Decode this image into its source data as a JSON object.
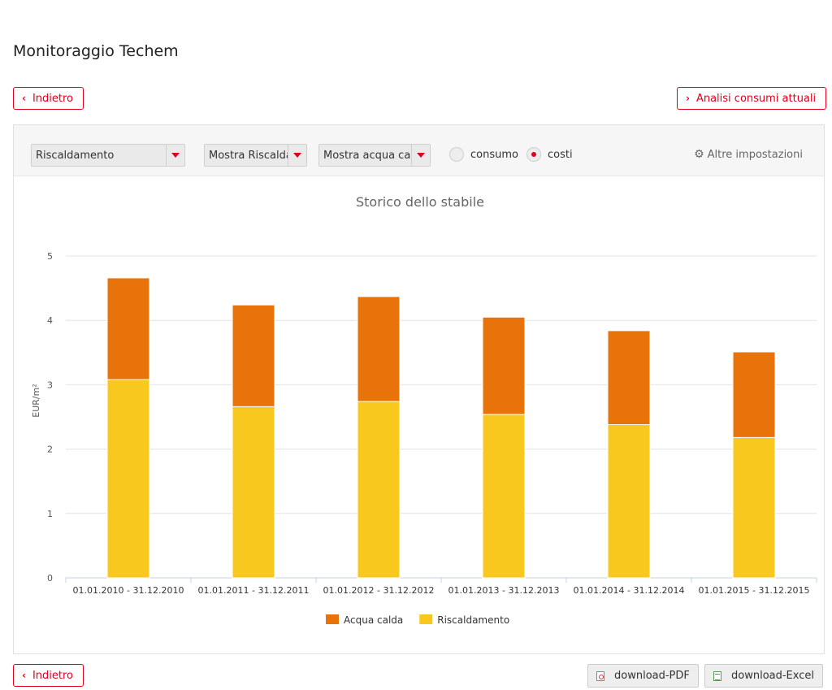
{
  "page": {
    "title": "Monitoraggio Techem"
  },
  "nav": {
    "back_label": "Indietro",
    "analysis_label": "Analisi consumi attuali",
    "back_bottom_label": "Indietro"
  },
  "toolbar": {
    "type_select": "Riscaldamento",
    "heating_select": "Mostra Riscalda",
    "water_select": "Mostra acqua calc",
    "radio_consumption": "consumo",
    "radio_costs": "costi",
    "radio_selected": "costi",
    "settings_label": "Altre impostazioni",
    "settings_icon": "gear-icon"
  },
  "chart_data": {
    "type": "bar",
    "stacked": true,
    "title": "Storico dello stabile",
    "xlabel": "",
    "ylabel": "EUR/m²",
    "ylim": [
      0,
      5
    ],
    "yticks": [
      "0",
      "1",
      "2",
      "3",
      "4",
      "5"
    ],
    "grid": true,
    "legend_position": "bottom",
    "categories": [
      "01.01.2010 - 31.12.2010",
      "01.01.2011 - 31.12.2011",
      "01.01.2012 - 31.12.2012",
      "01.01.2013 - 31.12.2013",
      "01.01.2014 - 31.12.2014",
      "01.01.2015 - 31.12.2015"
    ],
    "series": [
      {
        "name": "Riscaldamento",
        "color": "#f9c81e",
        "values": [
          3.08,
          2.66,
          2.74,
          2.54,
          2.38,
          2.18
        ]
      },
      {
        "name": "Acqua calda",
        "color": "#e8730a",
        "values": [
          1.58,
          1.58,
          1.63,
          1.51,
          1.46,
          1.33
        ]
      }
    ],
    "legend_order": [
      "Acqua calda",
      "Riscaldamento"
    ]
  },
  "downloads": {
    "pdf_label": "download-PDF",
    "excel_label": "download-Excel"
  }
}
